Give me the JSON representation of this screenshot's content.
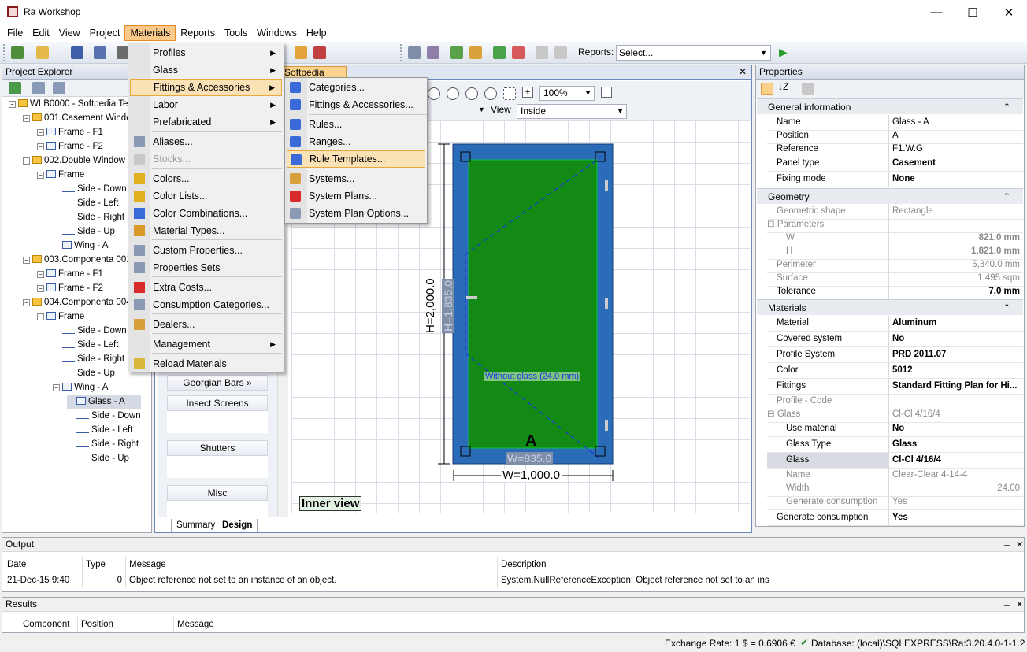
{
  "window": {
    "title": "Ra Workshop",
    "minimize": "—",
    "maximize": "☐",
    "close": "✕"
  },
  "menu": [
    "File",
    "Edit",
    "View",
    "Project",
    "Materials",
    "Reports",
    "Tools",
    "Windows",
    "Help"
  ],
  "toolbar": {
    "reports_label": "Reports:",
    "reports_select": "Select..."
  },
  "project_explorer": {
    "title": "Project Explorer",
    "tree": [
      {
        "label": "WLB0000 - Softpedia Tes",
        "level": 0
      },
      {
        "label": "001.Casement Windo",
        "level": 1
      },
      {
        "label": "Frame - F1",
        "level": 2
      },
      {
        "label": "Frame - F2",
        "level": 2
      },
      {
        "label": "002.Double Window",
        "level": 1
      },
      {
        "label": "Frame",
        "level": 2
      },
      {
        "label": "Side - Down",
        "level": 3
      },
      {
        "label": "Side - Left",
        "level": 3
      },
      {
        "label": "Side - Right",
        "level": 3
      },
      {
        "label": "Side - Up",
        "level": 3
      },
      {
        "label": "Wing - A",
        "level": 3
      },
      {
        "label": "003.Componenta 001",
        "level": 1
      },
      {
        "label": "Frame - F1",
        "level": 2
      },
      {
        "label": "Frame - F2",
        "level": 2
      },
      {
        "label": "004.Componenta 004",
        "level": 1
      },
      {
        "label": "Frame",
        "level": 2
      },
      {
        "label": "Side - Down",
        "level": 3
      },
      {
        "label": "Side - Left",
        "level": 3
      },
      {
        "label": "Side - Right",
        "level": 3
      },
      {
        "label": "Side - Up",
        "level": 3
      },
      {
        "label": "Wing - A",
        "level": 3
      },
      {
        "label": "Glass - A",
        "level": 4
      },
      {
        "label": "Side - Down",
        "level": 4
      },
      {
        "label": "Side - Left",
        "level": 4
      },
      {
        "label": "Side - Right",
        "level": 4
      },
      {
        "label": "Side - Up",
        "level": 4
      }
    ]
  },
  "document": {
    "tab": "Softpedia Test*",
    "zoom": "100%",
    "view_label": "View",
    "view_value": "Inside",
    "dim_height": "H=2,000.0",
    "dim_inner_height": "H=1,835.0",
    "dim_width": "W=1,000.0",
    "dim_inner_width": "W=835.0",
    "glass_label": "Without glass (24.0 mm)",
    "sash_label": "A",
    "inner_view": "Inner view",
    "palette": [
      "Georgian Bars",
      "Insect Screens",
      "Shutters",
      "Misc"
    ],
    "bottom_tabs": [
      "Summary",
      "Design"
    ],
    "frame_color": "#2b6cb8",
    "glass_color": "#138a13"
  },
  "materials_menu": [
    {
      "label": "Profiles",
      "sub": true
    },
    {
      "label": "Glass",
      "sub": true
    },
    {
      "label": "Fittings & Accessories",
      "sub": true
    },
    {
      "label": "Labor",
      "sub": true
    },
    {
      "label": "Prefabricated",
      "sub": true
    },
    {
      "label": "Aliases..."
    },
    {
      "label": "Stocks..."
    },
    {
      "label": "Colors..."
    },
    {
      "label": "Color Lists..."
    },
    {
      "label": "Color Combinations..."
    },
    {
      "label": "Material Types..."
    },
    {
      "label": "Custom Properties..."
    },
    {
      "label": "Properties Sets"
    },
    {
      "label": "Extra Costs..."
    },
    {
      "label": "Consumption Categories..."
    },
    {
      "label": "Dealers..."
    },
    {
      "label": "Management",
      "sub": true
    },
    {
      "label": "Reload Materials"
    }
  ],
  "fittings_submenu": [
    "Categories...",
    "Fittings & Accessories...",
    "Rules...",
    "Ranges...",
    "Rule Templates...",
    "Systems...",
    "System Plans...",
    "System Plan Options..."
  ],
  "properties": {
    "title": "Properties",
    "sections": [
      "General information",
      "Geometry",
      "Materials"
    ],
    "rows": [
      {
        "k": "Name",
        "v": "Glass - A"
      },
      {
        "k": "Position",
        "v": "A"
      },
      {
        "k": "Reference",
        "v": "F1.W.G"
      },
      {
        "k": "Panel type",
        "v": "Casement"
      },
      {
        "k": "Fixing mode",
        "v": "None"
      },
      {
        "k": "Geometric shape",
        "v": "Rectangle"
      },
      {
        "k": "Parameters",
        "v": ""
      },
      {
        "k": "W",
        "v": "821.0 mm"
      },
      {
        "k": "H",
        "v": "1,821.0 mm"
      },
      {
        "k": "Perimeter",
        "v": "5,340.0 mm"
      },
      {
        "k": "Surface",
        "v": "1.495 sqm"
      },
      {
        "k": "Tolerance",
        "v": "7.0 mm"
      },
      {
        "k": "Material",
        "v": "Aluminum"
      },
      {
        "k": "Covered system",
        "v": "No"
      },
      {
        "k": "Profile System",
        "v": "PRD 2011.07"
      },
      {
        "k": "Color",
        "v": "5012"
      },
      {
        "k": "Fittings",
        "v": "Standard Fitting Plan for Hi..."
      },
      {
        "k": "Profile - Code",
        "v": ""
      },
      {
        "k": "Glass",
        "v": "Cl-Cl 4/16/4"
      },
      {
        "k": "Use material",
        "v": "No"
      },
      {
        "k": "Glass Type",
        "v": "Glass"
      },
      {
        "k": "Glass",
        "v": "Cl-Cl 4/16/4"
      },
      {
        "k": "Name",
        "v": "Clear-Clear 4-14-4"
      },
      {
        "k": "Width",
        "v": "24.00"
      },
      {
        "k": "Generate consumption",
        "v": "Yes"
      },
      {
        "k": "Generate consumption",
        "v": "Yes"
      }
    ]
  },
  "output": {
    "title": "Output",
    "columns": [
      "Date",
      "Type",
      "Message",
      "Description"
    ],
    "row": [
      "21-Dec-15 9:40",
      "0",
      "Object reference not set to an instance of an object.",
      "System.NullReferenceException: Object reference not set to an inst..."
    ]
  },
  "results": {
    "title": "Results",
    "columns": [
      "Component",
      "Position",
      "Message"
    ]
  },
  "status": {
    "exchange": "Exchange Rate: 1 $ = 0.6906 €",
    "database": "Database: (local)\\SQLEXPRESS\\Ra:3.20.4.0-1-1.2"
  }
}
